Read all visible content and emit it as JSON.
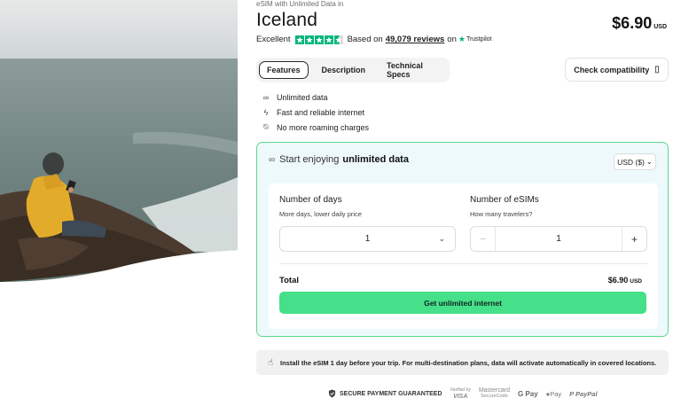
{
  "header": {
    "eyebrow": "eSIM with Unlimited Data in",
    "title": "Iceland",
    "price": "$6.90",
    "price_currency": "USD"
  },
  "rating": {
    "label": "Excellent",
    "stars": 4.5,
    "based_on": "Based on",
    "review_count": "49,079 reviews",
    "on": "on",
    "provider": "Trustpilot",
    "star_color": "#00b67a"
  },
  "tabs": [
    {
      "label": "Features",
      "active": true
    },
    {
      "label": "Description",
      "active": false
    },
    {
      "label": "Technical Specs",
      "active": false
    }
  ],
  "compatibility_button": "Check compatibility",
  "features": [
    {
      "icon": "infinity-icon",
      "label": "Unlimited data"
    },
    {
      "icon": "lightning-icon",
      "label": "Fast and reliable internet"
    },
    {
      "icon": "no-roaming-icon",
      "label": "No more roaming charges"
    }
  ],
  "card": {
    "heading_prefix": "Start enjoying",
    "heading_strong": "unlimited data",
    "currency_selector": "USD ($)",
    "days_label": "Number of days",
    "days_sub": "More days, lower daily price",
    "days_value": "1",
    "esims_label": "Number of eSIMs",
    "esims_sub": "How many travelers?",
    "esims_value": "1",
    "minus": "−",
    "plus": "+",
    "total_label": "Total",
    "total_value": "$6.90",
    "total_currency": "USD",
    "buy_button": "Get unlimited internet",
    "accent": "#45e089"
  },
  "info_banner": "Install the eSIM 1 day before your trip. For multi-destination plans, data will activate automatically in covered locations.",
  "payment": {
    "secure_label": "SECURE PAYMENT GUARANTEED",
    "visa_top": "Verified by",
    "visa_bottom": "VISA",
    "mc_top": "Mastercard",
    "mc_bottom": "SecureCode",
    "gpay": "G Pay",
    "apay": "Pay",
    "paypal": "PayPal"
  }
}
